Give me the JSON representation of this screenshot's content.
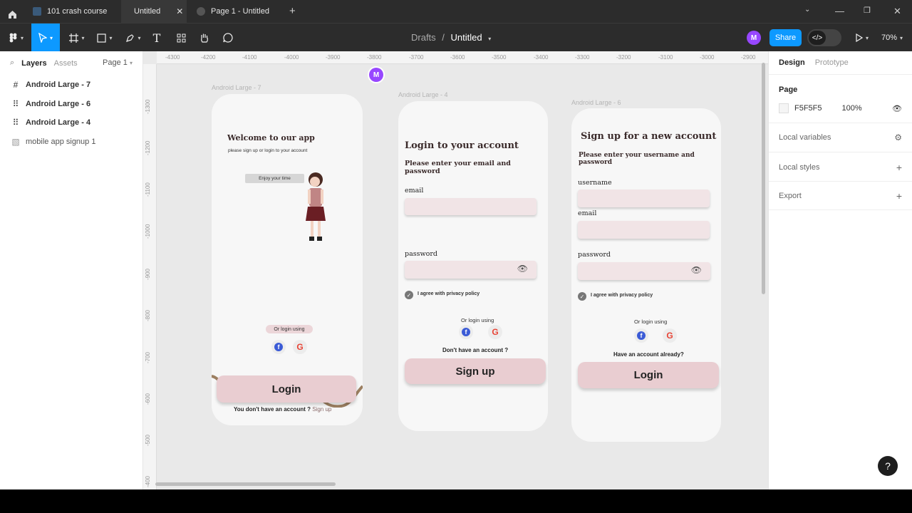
{
  "tabs": [
    {
      "label": "101 crash course"
    },
    {
      "label": "Untitled"
    },
    {
      "label": "Page 1 - Untitled"
    }
  ],
  "toolbar": {
    "breadcrumb_drafts": "Drafts",
    "breadcrumb_sep": "/",
    "file_name": "Untitled",
    "user_initial": "M",
    "share_label": "Share",
    "zoom": "70%"
  },
  "left_panel": {
    "tab_layers": "Layers",
    "tab_assets": "Assets",
    "page_selector": "Page 1",
    "layers": [
      {
        "label": "Android Large - 7"
      },
      {
        "label": "Android Large - 6"
      },
      {
        "label": "Android Large - 4"
      },
      {
        "label": "mobile app signup 1"
      }
    ]
  },
  "rulers": {
    "top": [
      "-4300",
      "-4200",
      "-4100",
      "-4000",
      "-3900",
      "-3800",
      "-3700",
      "-3600",
      "-3500",
      "-3400",
      "-3300",
      "-3200",
      "-3100",
      "-3000",
      "-2900"
    ],
    "left": [
      "-1300",
      "-1200",
      "-1100",
      "-1000",
      "-900",
      "-800",
      "-700",
      "-600",
      "-500",
      "-400"
    ]
  },
  "frame7": {
    "label": "Android Large - 7",
    "title": "Welcome to our app",
    "subtitle": "please sign up or login to your account",
    "bubble": "Enjoy your time",
    "or_login": "Or login using",
    "login_button": "Login",
    "no_account": "You don't have an account ?",
    "signup_link": "Sign up"
  },
  "frame4": {
    "label": "Android Large - 4",
    "title": "Login to your account",
    "subtitle": "Please enter your email and password",
    "email_label": "email",
    "password_label": "password",
    "agree": "I agree with privacy policy",
    "or_login": "Or login using",
    "no_account": "Don't have an account ?",
    "signup_button": "Sign up"
  },
  "frame6": {
    "label": "Android Large - 6",
    "title": "Sign up for a new account",
    "subtitle": "Please enter your username and password",
    "username_label": "username",
    "email_label": "email",
    "password_label": "password",
    "agree": "I agree with privacy policy",
    "or_login": "Or login using",
    "have_account": "Have an account already?",
    "login_button": "Login"
  },
  "right_panel": {
    "tab_design": "Design",
    "tab_prototype": "Prototype",
    "page_heading": "Page",
    "page_color": "F5F5F5",
    "page_opacity": "100%",
    "local_variables": "Local variables",
    "local_styles": "Local styles",
    "export": "Export"
  },
  "colors": {
    "accent": "#0d99ff",
    "avatar": "#9747ff",
    "field": "#f1e4e6",
    "button": "#e9cdd1"
  }
}
